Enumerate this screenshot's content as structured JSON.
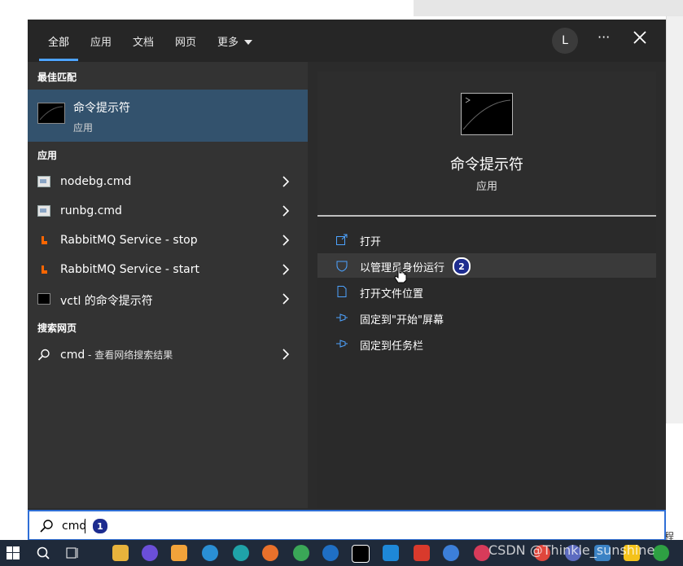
{
  "background": {
    "right_edge_text": "程去"
  },
  "tabs": [
    {
      "label": "全部"
    },
    {
      "label": "应用"
    },
    {
      "label": "文档"
    },
    {
      "label": "网页"
    },
    {
      "label": "更多"
    }
  ],
  "header": {
    "avatar_initial": "L",
    "more_label": "···"
  },
  "left": {
    "best_match_header": "最佳匹配",
    "best_match": {
      "title": "命令提示符",
      "subtitle": "应用"
    },
    "apps_header": "应用",
    "apps": [
      {
        "label": "nodebg.cmd",
        "icon": "script-icon"
      },
      {
        "label": "runbg.cmd",
        "icon": "script-icon"
      },
      {
        "label": "RabbitMQ Service - stop",
        "icon": "rabbitmq-icon"
      },
      {
        "label": "RabbitMQ Service - start",
        "icon": "rabbitmq-icon"
      },
      {
        "label": "vctl 的命令提示符",
        "icon": "cmd-icon"
      }
    ],
    "web_header": "搜索网页",
    "web_result": {
      "query": "cmd",
      "suffix": " - 查看网络搜索结果"
    }
  },
  "right": {
    "app_title": "命令提示符",
    "app_subtitle": "应用",
    "actions": [
      {
        "label": "打开",
        "icon": "open-icon"
      },
      {
        "label": "以管理员身份运行",
        "icon": "shield-icon"
      },
      {
        "label": "打开文件位置",
        "icon": "file-location-icon"
      },
      {
        "label": "固定到\"开始\"屏幕",
        "icon": "pin-icon"
      },
      {
        "label": "固定到任务栏",
        "icon": "pin-icon"
      }
    ],
    "badge_2": "2"
  },
  "search": {
    "value": "cmd",
    "badge_1": "1"
  },
  "watermark": "CSDN @Thinkle_sunshine",
  "colors": {
    "accent": "#4da3ff",
    "selected_row": "#33526d",
    "badge": "#1d2c8f",
    "rabbitmq": "#ff6600"
  }
}
